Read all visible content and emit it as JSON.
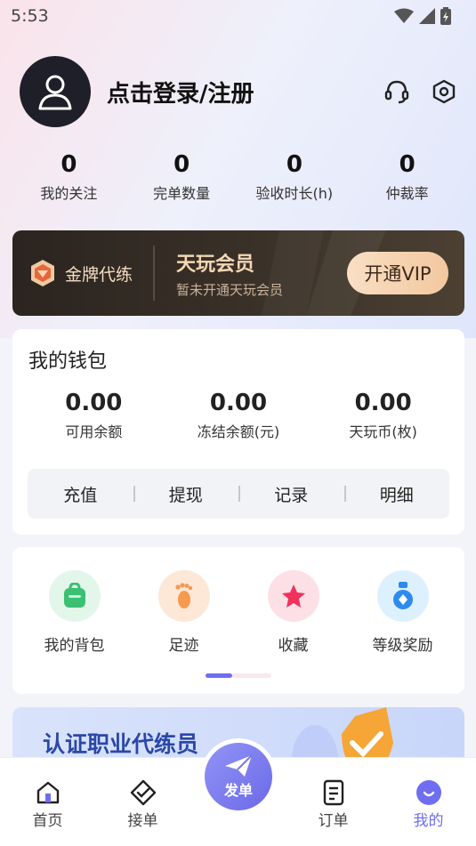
{
  "status_bar": {
    "time": "5:53"
  },
  "profile": {
    "login_text": "点击登录/注册"
  },
  "stats": [
    {
      "value": "0",
      "label": "我的关注"
    },
    {
      "value": "0",
      "label": "完单数量"
    },
    {
      "value": "0",
      "label": "验收时长(h)"
    },
    {
      "value": "0",
      "label": "仲裁率"
    }
  ],
  "vip": {
    "badge_label": "金牌代练",
    "title": "天玩会员",
    "subtitle": "暂未开通天玩会员",
    "button": "开通VIP"
  },
  "wallet": {
    "title": "我的钱包",
    "amounts": [
      {
        "value": "0.00",
        "label": "可用余额"
      },
      {
        "value": "0.00",
        "label": "冻结余额(元)"
      },
      {
        "value": "0.00",
        "label": "天玩币(枚)"
      }
    ],
    "actions": [
      "充值",
      "提现",
      "记录",
      "明细"
    ]
  },
  "tools": [
    {
      "label": "我的背包",
      "icon": "backpack-icon"
    },
    {
      "label": "足迹",
      "icon": "footprint-icon"
    },
    {
      "label": "收藏",
      "icon": "star-icon"
    },
    {
      "label": "等级奖励",
      "icon": "medal-icon"
    }
  ],
  "banner": {
    "title": "认证职业代练员"
  },
  "bottom_nav": {
    "items": [
      {
        "label": "首页"
      },
      {
        "label": "接单"
      },
      {
        "label": "订单"
      },
      {
        "label": "我的"
      }
    ],
    "publish_label": "发单"
  },
  "colors": {
    "accent": "#6f6ef0",
    "vip_gold": "#f4d7b3"
  }
}
